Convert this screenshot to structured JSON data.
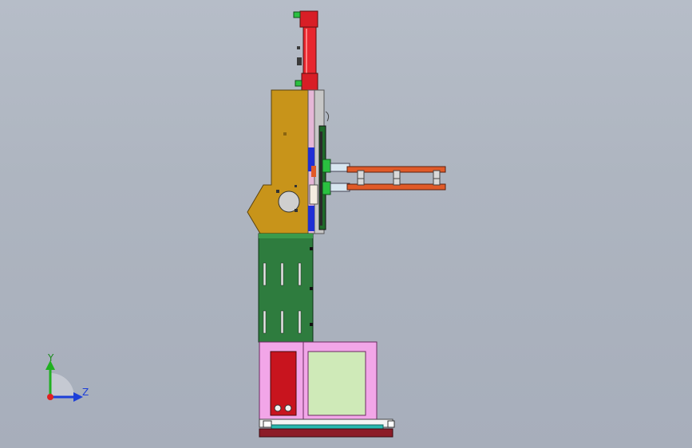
{
  "view": {
    "triad": {
      "y_label": "Y",
      "z_label": "Z",
      "x_color": "#e02020",
      "y_color": "#20b020",
      "z_color": "#1d3fd8"
    }
  },
  "colors": {
    "cylinder": "#e0202a",
    "gold_plate": "#c89418",
    "green_column": "#2e7c3e",
    "pink_frame": "#f2a6e8",
    "light_green_panel": "#cfeab8",
    "orange_arm": "#e05a28",
    "base_maroon": "#8c1c28",
    "base_teal": "#28b8b0"
  }
}
